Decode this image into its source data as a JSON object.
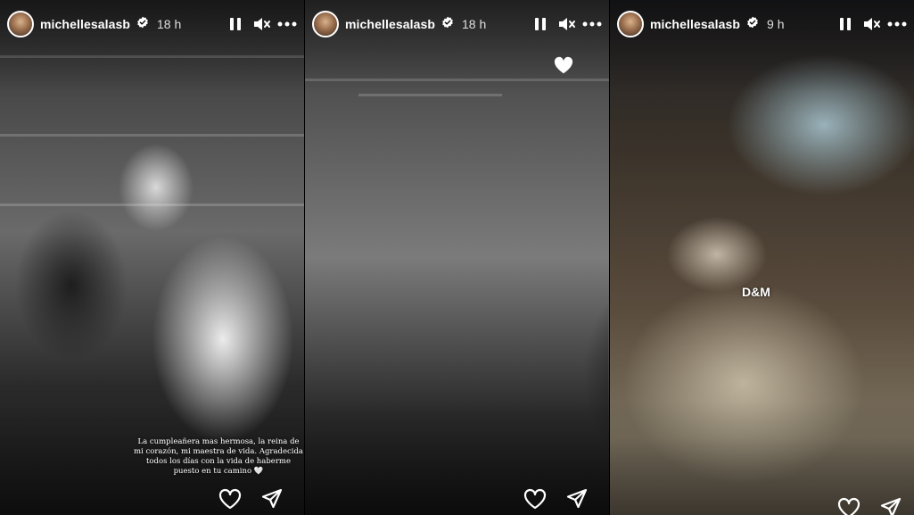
{
  "stories": [
    {
      "username": "michellesalasb",
      "time": "18 h",
      "caption": "La cumpleañera mas hermosa, la reina de mi corazón, mi maestra de vida. Agradecida todos los días con la vida de haberme puesto en tu camino 🤍",
      "style": "black-and-white"
    },
    {
      "username": "michellesalasb",
      "time": "18 h",
      "style": "black-and-white"
    },
    {
      "username": "michellesalasb",
      "time": "9 h",
      "sticker": "D&M",
      "style": "color"
    }
  ],
  "icons": {
    "verified": "verified-badge-icon",
    "pause": "pause-icon",
    "mute": "speaker-muted-icon",
    "more": "more-options-icon",
    "like": "heart-icon",
    "share": "send-icon"
  },
  "colors": {
    "text": "#ffffff",
    "verified_badge": "#ffffff"
  }
}
